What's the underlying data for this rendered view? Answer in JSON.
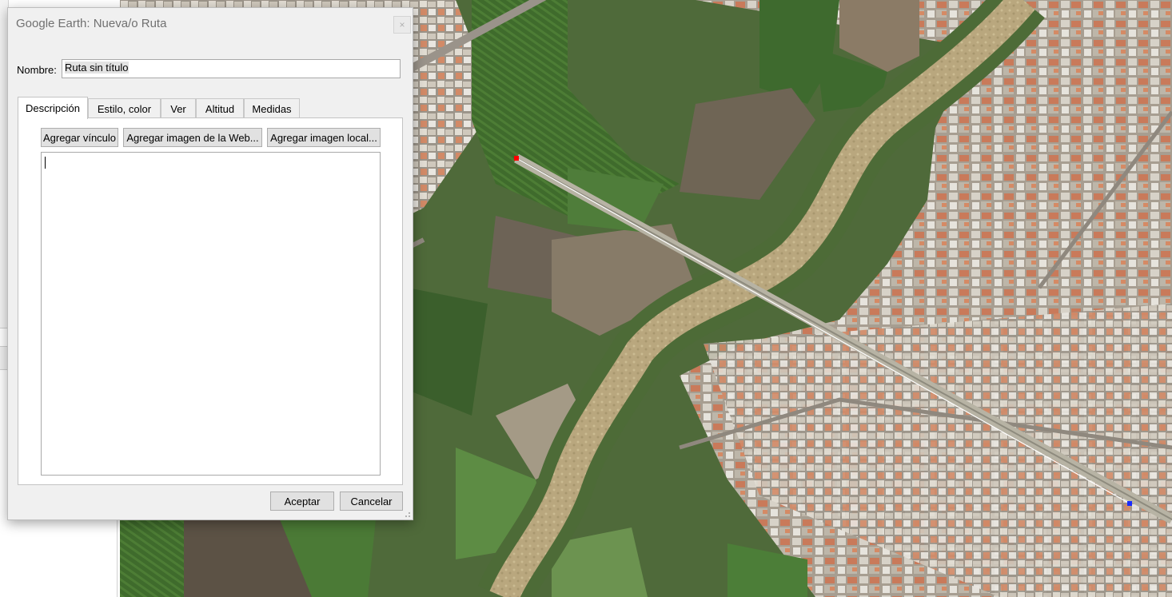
{
  "dialog": {
    "title": "Google Earth: Nueva/o Ruta",
    "close_label": "×",
    "name_label": "Nombre:",
    "name_value": "Ruta sin título",
    "tabs": [
      {
        "label": "Descripción",
        "active": true
      },
      {
        "label": "Estilo, color",
        "active": false
      },
      {
        "label": "Ver",
        "active": false
      },
      {
        "label": "Altitud",
        "active": false
      },
      {
        "label": "Medidas",
        "active": false
      }
    ],
    "description_buttons": {
      "add_link": "Agregar vínculo",
      "add_web_image": "Agregar imagen de la Web...",
      "add_local_image": "Agregar imagen local..."
    },
    "description_text": "",
    "ok_label": "Aceptar",
    "cancel_label": "Cancelar"
  },
  "map": {
    "type": "satellite-imagery",
    "path_color": "#ffffff",
    "start_marker_color": "#ff0000",
    "end_marker_color": "#1a2cff"
  }
}
